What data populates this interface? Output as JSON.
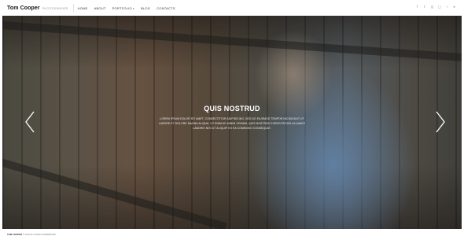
{
  "header": {
    "brand_name": "Tom Cooper",
    "brand_tagline": "PHOTOGRAPHER",
    "nav": [
      {
        "label": "HOME"
      },
      {
        "label": "ABOUT"
      },
      {
        "label": "PORTFOLIO"
      },
      {
        "label": "BLOG"
      },
      {
        "label": "CONTACTS"
      }
    ],
    "social_icons": [
      "facebook-icon",
      "twitter-icon",
      "google-plus-icon",
      "instagram-icon",
      "flickr-icon",
      "youtube-icon"
    ]
  },
  "slide": {
    "title": "QUIS NOSTRUD",
    "text": "LOREM IPSUM DOLOR SIT AMET, CONSECTETUR ADIPISICING, SED DO EIUSMOD TEMPOR INCIDIDUNT UT LABORE ET DOLORE MAGNA ALIQUA. UT ENIM AD MINIM VENIAM, QUIS NOSTRUD EXERCITATION ULLAMCO LABORIS NISI UT ALIQUIP EX EA COMMODO CONSEQUAT."
  },
  "footer": {
    "brand": "TOM COOPER",
    "text": "© 2016 ALL RIGHTS RESERVED"
  }
}
